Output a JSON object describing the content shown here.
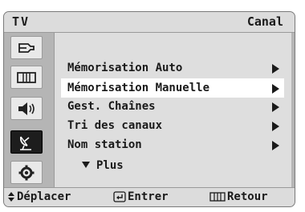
{
  "header": {
    "source": "TV",
    "title": "Canal"
  },
  "sidebar": {
    "items": [
      {
        "icon": "input-source-icon",
        "active": false
      },
      {
        "icon": "picture-icon",
        "active": false
      },
      {
        "icon": "sound-icon",
        "active": false
      },
      {
        "icon": "channel-satellite-icon",
        "active": true
      },
      {
        "icon": "setup-gear-icon",
        "active": false
      }
    ]
  },
  "menu": {
    "items": [
      {
        "label": "Mémorisation Auto",
        "selected": false
      },
      {
        "label": "Mémorisation Manuelle",
        "selected": true
      },
      {
        "label": "Gest. Chaînes",
        "selected": false
      },
      {
        "label": "Tri des canaux",
        "selected": false
      },
      {
        "label": "Nom station",
        "selected": false
      }
    ],
    "more_label": "Plus"
  },
  "footer": {
    "move_label": "Déplacer",
    "enter_label": "Entrer",
    "return_label": "Retour"
  },
  "colors": {
    "frame": "#b5b5b5",
    "panel": "#dedede",
    "highlight": "#ffffff",
    "active_icon_bg": "#1d1d1d"
  }
}
